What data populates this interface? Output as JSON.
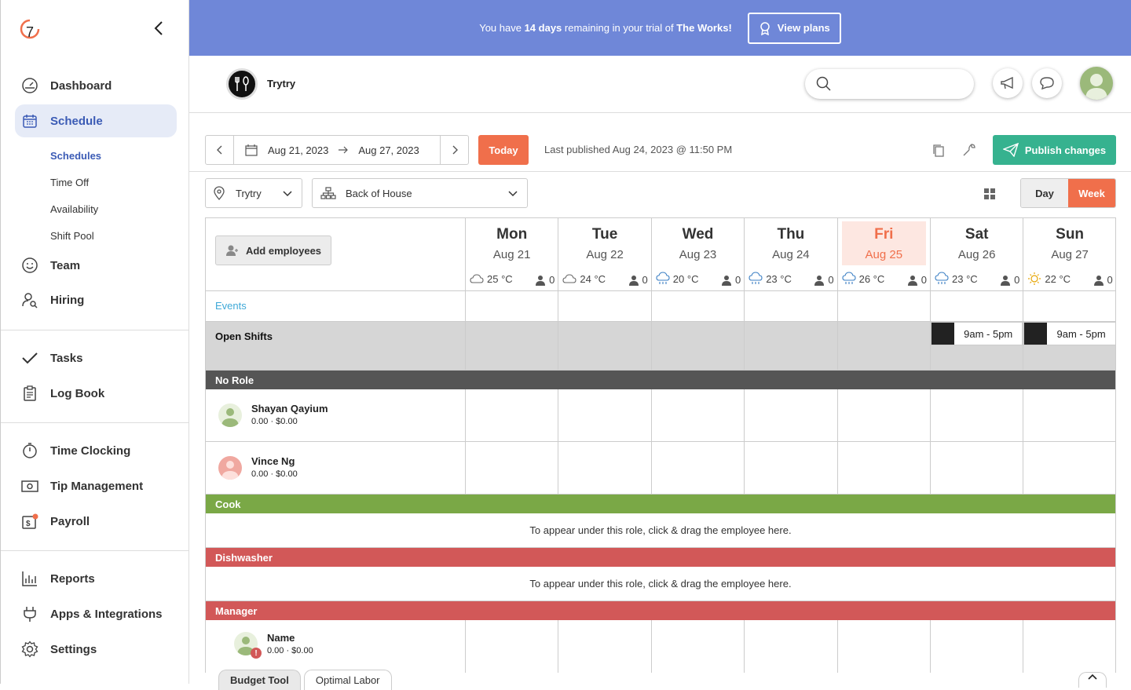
{
  "sidebar": {
    "collapse_icon": "chevron-left-icon",
    "items": [
      {
        "label": "Dashboard",
        "icon": "dashboard-icon"
      },
      {
        "label": "Schedule",
        "icon": "calendar-icon"
      },
      {
        "label": "Team",
        "icon": "smile-icon"
      },
      {
        "label": "Hiring",
        "icon": "person-search-icon"
      },
      {
        "label": "Tasks",
        "icon": "check-icon"
      },
      {
        "label": "Log Book",
        "icon": "clipboard-icon"
      },
      {
        "label": "Time Clocking",
        "icon": "stopwatch-icon"
      },
      {
        "label": "Tip Management",
        "icon": "money-icon"
      },
      {
        "label": "Payroll",
        "icon": "payroll-icon"
      },
      {
        "label": "Reports",
        "icon": "bar-chart-icon"
      },
      {
        "label": "Apps & Integrations",
        "icon": "plug-icon"
      },
      {
        "label": "Settings",
        "icon": "gear-icon"
      }
    ],
    "schedule_sub": [
      "Schedules",
      "Time Off",
      "Availability",
      "Shift Pool"
    ]
  },
  "banner": {
    "prefix": "You have ",
    "days": "14 days",
    "middle": " remaining in your trial of ",
    "plan": "The Works!",
    "button": "View plans"
  },
  "topbar": {
    "business_name": "Trytry",
    "search_placeholder": ""
  },
  "toolbar": {
    "start_date": "Aug 21, 2023",
    "end_date": "Aug 27, 2023",
    "today": "Today",
    "last_published": "Last published Aug 24, 2023 @ 11:50 PM",
    "publish": "Publish changes"
  },
  "filters": {
    "location": "Trytry",
    "department": "Back of House",
    "day": "Day",
    "week": "Week"
  },
  "grid": {
    "add_employees": "Add employees",
    "events_label": "Events",
    "open_shifts_label": "Open Shifts",
    "days": [
      {
        "name": "Mon",
        "date": "Aug 21",
        "temp": "25 °C",
        "weather": "cloud-icon",
        "count": "0",
        "today": false
      },
      {
        "name": "Tue",
        "date": "Aug 22",
        "temp": "24 °C",
        "weather": "cloud-icon",
        "count": "0",
        "today": false
      },
      {
        "name": "Wed",
        "date": "Aug 23",
        "temp": "20 °C",
        "weather": "rain-icon",
        "count": "0",
        "today": false
      },
      {
        "name": "Thu",
        "date": "Aug 24",
        "temp": "23 °C",
        "weather": "rain-icon",
        "count": "0",
        "today": false
      },
      {
        "name": "Fri",
        "date": "Aug 25",
        "temp": "26 °C",
        "weather": "rain-icon",
        "count": "0",
        "today": true
      },
      {
        "name": "Sat",
        "date": "Aug 26",
        "temp": "23 °C",
        "weather": "rain-icon",
        "count": "0",
        "today": false
      },
      {
        "name": "Sun",
        "date": "Aug 27",
        "temp": "22 °C",
        "weather": "sun-icon",
        "count": "0",
        "today": false
      }
    ],
    "open_shifts": [
      {
        "day": "Sat",
        "time": "9am - 5pm"
      },
      {
        "day": "Sun",
        "time": "9am - 5pm"
      }
    ],
    "roles": {
      "no_role": {
        "label": "No Role",
        "color": "#555555"
      },
      "cook": {
        "label": "Cook",
        "color": "#7aa846"
      },
      "dishwasher": {
        "label": "Dishwasher",
        "color": "#d25858"
      },
      "manager": {
        "label": "Manager",
        "color": "#d25858"
      }
    },
    "drag_hint": "To appear under this role, click & drag the employee here.",
    "employees": [
      {
        "name": "Shayan Qayium",
        "meta": "0.00 · $0.00"
      },
      {
        "name": "Vince Ng",
        "meta": "0.00 · $0.00"
      },
      {
        "name": "Name",
        "meta": "0.00 · $0.00"
      }
    ]
  },
  "bottom_tabs": [
    "Budget Tool",
    "Optimal Labor"
  ],
  "colors": {
    "accent": "#f06f4b",
    "primary": "#3b5bb5",
    "banner": "#6f87d8",
    "publish": "#36b28f"
  }
}
